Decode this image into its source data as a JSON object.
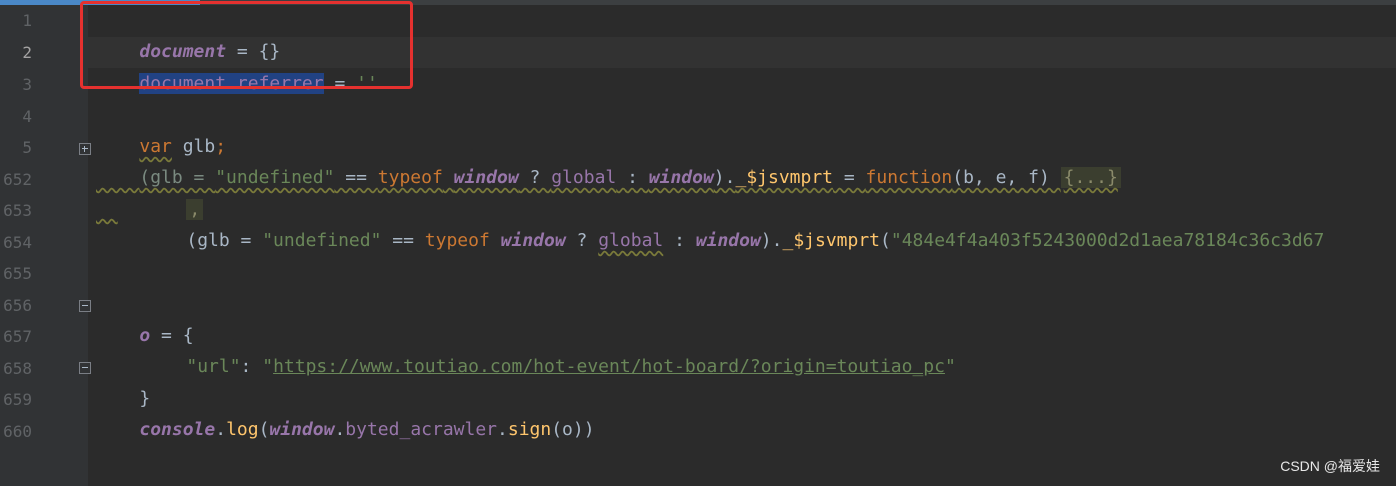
{
  "gutter": {
    "line_numbers": [
      "1",
      "2",
      "3",
      "4",
      "5",
      "652",
      "653",
      "654",
      "655",
      "656",
      "657",
      "658",
      "659",
      "660"
    ]
  },
  "code": {
    "l1": {
      "ident": "document",
      "rest": " = {}"
    },
    "l2": {
      "obj": "document",
      "dot": ".",
      "prop": "referrer",
      "op": " = ",
      "str": "''"
    },
    "l4": {
      "kw": "var",
      "rest": " glb",
      "semi": ";"
    },
    "l5": {
      "p1": "(glb = ",
      "s1": "\"undefined\"",
      "p2": " == ",
      "k1": "typeof",
      "p3": " ",
      "g1": "window",
      "p4": " ? ",
      "g2": "global",
      "p5": " : ",
      "g3": "window",
      "p6": ").",
      "f1": "_$jsvmprt",
      "p7": " = ",
      "k2": "function",
      "p8": "(b, e, f) ",
      "folded": "{...}"
    },
    "l652": {
      "comma": ","
    },
    "l653": {
      "p1": "(glb = ",
      "s1": "\"undefined\"",
      "p2": " == ",
      "k1": "typeof",
      "p3": " ",
      "g1": "window",
      "p4": " ? ",
      "g2": "global",
      "p5": " : ",
      "g3": "window",
      "p6": ").",
      "f1": "_$jsvmprt",
      "p7": "(",
      "s2": "\"484e4f4a403f5243000d2d1aea78184c36c3d67"
    },
    "l656": {
      "ident": "o",
      "rest": " = {"
    },
    "l657": {
      "key": "\"url\"",
      "colon": ": ",
      "q1": "\"",
      "url": "https://www.toutiao.com/hot-event/hot-board/?origin=toutiao_pc",
      "q2": "\""
    },
    "l658": {
      "close": "}"
    },
    "l659": {
      "obj": "console",
      "dot1": ".",
      "fn1": "log",
      "p1": "(",
      "g1": "window",
      "dot2": ".",
      "prop": "byted_acrawler",
      "dot3": ".",
      "fn2": "sign",
      "p2": "(o))"
    }
  },
  "watermark": "CSDN @福爱娃",
  "colors": {
    "background": "#2b2b2b",
    "gutter": "#313335",
    "annotation": "#e5312f",
    "selection": "#214283"
  }
}
